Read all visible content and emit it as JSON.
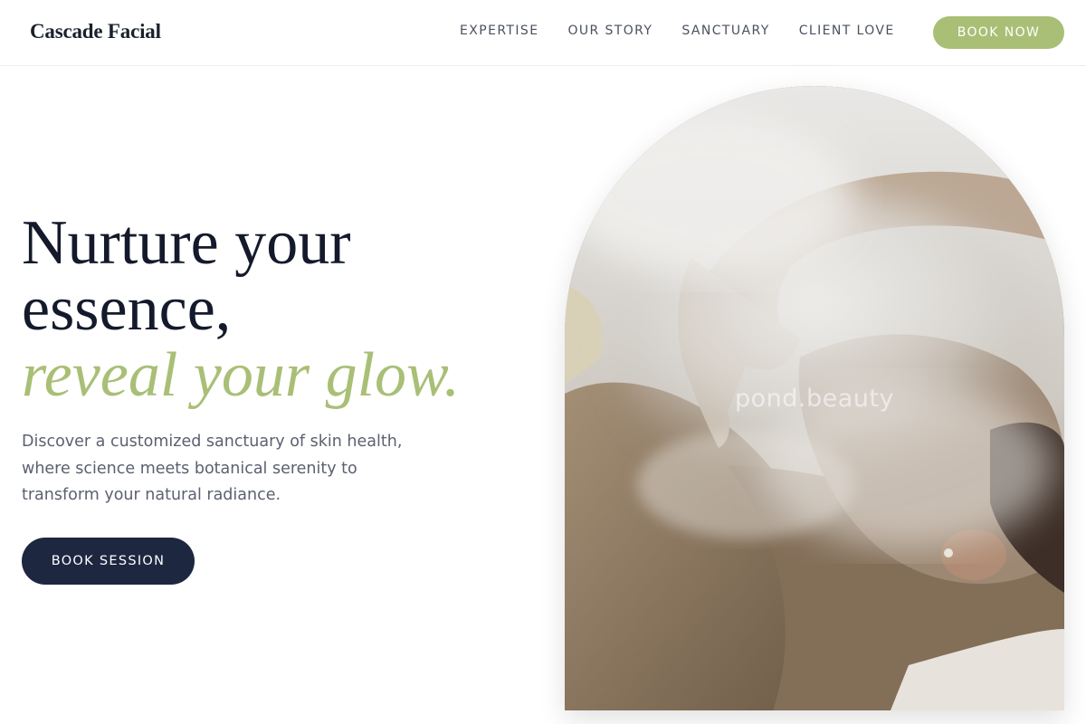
{
  "brand": {
    "name": "Cascade Facial"
  },
  "nav": {
    "items": [
      {
        "label": "EXPERTISE"
      },
      {
        "label": "OUR STORY"
      },
      {
        "label": "SANCTUARY"
      },
      {
        "label": "CLIENT LOVE"
      }
    ],
    "cta_label": "BOOK NOW"
  },
  "hero": {
    "title_line1": "Nurture your",
    "title_line2": "essence,",
    "title_accent": "reveal your glow.",
    "description": "Discover a customized sanctuary of skin health, where science meets botanical serenity to transform your natural radiance.",
    "cta_label": "BOOK SESSION",
    "image_watermark": "pond.beauty"
  },
  "colors": {
    "accent": "#a9bf76",
    "primary_dark": "#1d2740",
    "heading": "#141a2b",
    "body_text": "#5b6170"
  },
  "icons": []
}
